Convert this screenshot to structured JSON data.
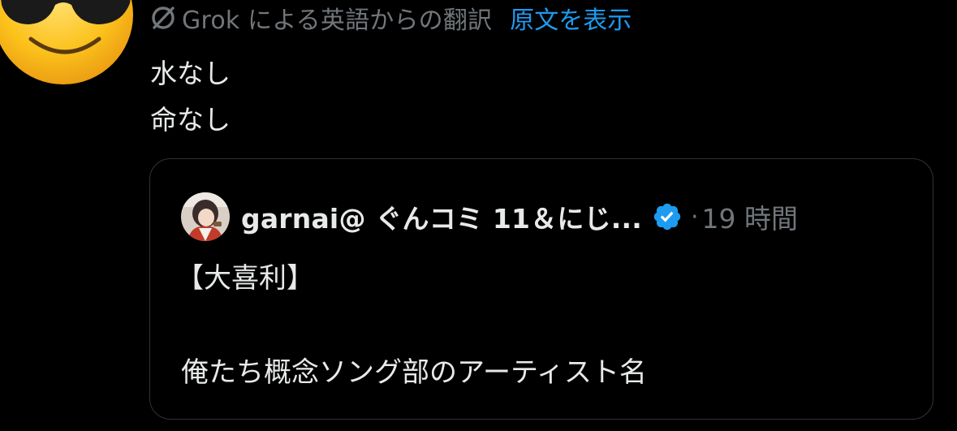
{
  "author": {
    "avatar_icon": "sunglasses-emoji-avatar"
  },
  "translation": {
    "icon": "grok-icon",
    "label": "Grok による英語からの翻訳",
    "show_original": "原文を表示"
  },
  "tweet": {
    "lines": [
      "水なし",
      "命なし"
    ]
  },
  "quote": {
    "author_name": "garnai@ ぐんコミ 11＆にじ...",
    "verified_icon": "verified-badge-icon",
    "separator": "·",
    "time": "19 時間",
    "title": "【大喜利】",
    "body": "俺たち概念ソング部のアーティスト名"
  },
  "colors": {
    "background": "#000000",
    "text": "#e7e9ea",
    "secondary": "#71767b",
    "link": "#1d9bf0",
    "border": "#2f3336",
    "verified": "#1d9bf0"
  }
}
